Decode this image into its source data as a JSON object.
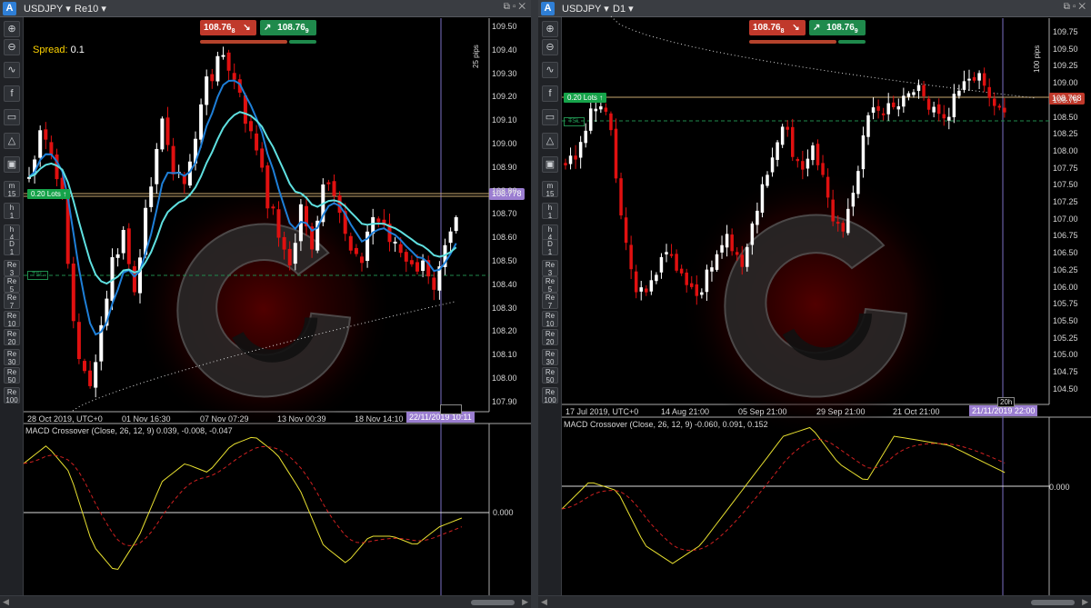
{
  "left": {
    "symbol": "USDJPY",
    "timeframe": "Re10",
    "sell_price": "108.76",
    "sell_sup": "8",
    "buy_price": "108.76",
    "buy_sup": "9",
    "spread_label": "Spread:",
    "spread_value": "0.1",
    "lots": "0.20 Lots",
    "tsl": "TSL",
    "price_tag": "108.778",
    "pips": "25 pips",
    "axis": [
      "109.50",
      "109.40",
      "109.30",
      "109.20",
      "109.10",
      "109.00",
      "108.90",
      "108.80",
      "108.70",
      "108.60",
      "108.50",
      "108.40",
      "108.30",
      "108.20",
      "108.10",
      "108.00",
      "107.90"
    ],
    "dates": [
      "28 Oct 2019, UTC+0",
      "01 Nov 16:30",
      "07 Nov 07:29",
      "13 Nov 00:39",
      "18 Nov 14:10"
    ],
    "date_tag": "22/11/2019 10:11",
    "macd_title": "MACD Crossover (Close, 26, 12, 9) 0.039, -0.008, -0.047",
    "macd_zero": "0.000"
  },
  "right": {
    "symbol": "USDJPY",
    "timeframe": "D1",
    "sell_price": "108.76",
    "sell_sup": "8",
    "buy_price": "108.76",
    "buy_sup": "9",
    "lots": "0.20 Lots",
    "tsl": "TSL",
    "price_tag": "108.768",
    "pips": "100 pips",
    "axis": [
      "109.75",
      "109.50",
      "109.25",
      "109.00",
      "108.75",
      "108.50",
      "108.25",
      "108.00",
      "107.75",
      "107.50",
      "107.25",
      "107.00",
      "106.75",
      "106.50",
      "106.25",
      "106.00",
      "105.75",
      "105.50",
      "105.25",
      "105.00",
      "104.75",
      "104.50"
    ],
    "dates": [
      "17 Jul 2019, UTC+0",
      "14 Aug 21:00",
      "05 Sep 21:00",
      "29 Sep 21:00",
      "21 Oct 21:00"
    ],
    "date_tag": "21/11/2019 22:00",
    "small_tag": "20h",
    "macd_title": "MACD Crossover (Close, 26, 12, 9) -0.060, 0.091, 0.152",
    "macd_zero": "0.000"
  },
  "toolbar": [
    "zoom-in",
    "zoom-out",
    "indicator",
    "facebook",
    "chart-type",
    "shapes",
    "snapshot",
    "m 15",
    "h 1",
    "h 4",
    "D 1",
    "Re 3",
    "Re 5",
    "Re 7",
    "Re 10",
    "Re 20",
    "Re 30",
    "Re 50",
    "Re 100"
  ],
  "colors": {
    "bull": "#ffffff",
    "bear": "#e01010",
    "ma_fast": "#1e7fd8",
    "ma_slow": "#5fe0e0",
    "macd": "#e8e030",
    "signal": "#d02020"
  }
}
